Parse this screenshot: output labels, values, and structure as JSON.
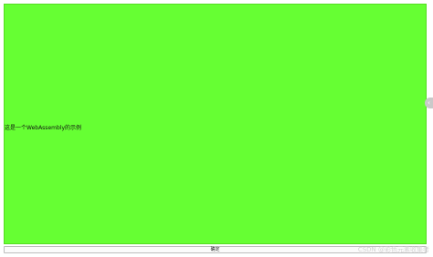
{
  "canvas": {
    "background_color": "#66ff33",
    "message": "这是一个WebAssembly的示例"
  },
  "side_button": {
    "icon": "expand-icon",
    "glyph": "‹"
  },
  "bottom_button": {
    "label": "确定"
  },
  "watermark": {
    "text": "CSDN @彩色元素收集者"
  }
}
